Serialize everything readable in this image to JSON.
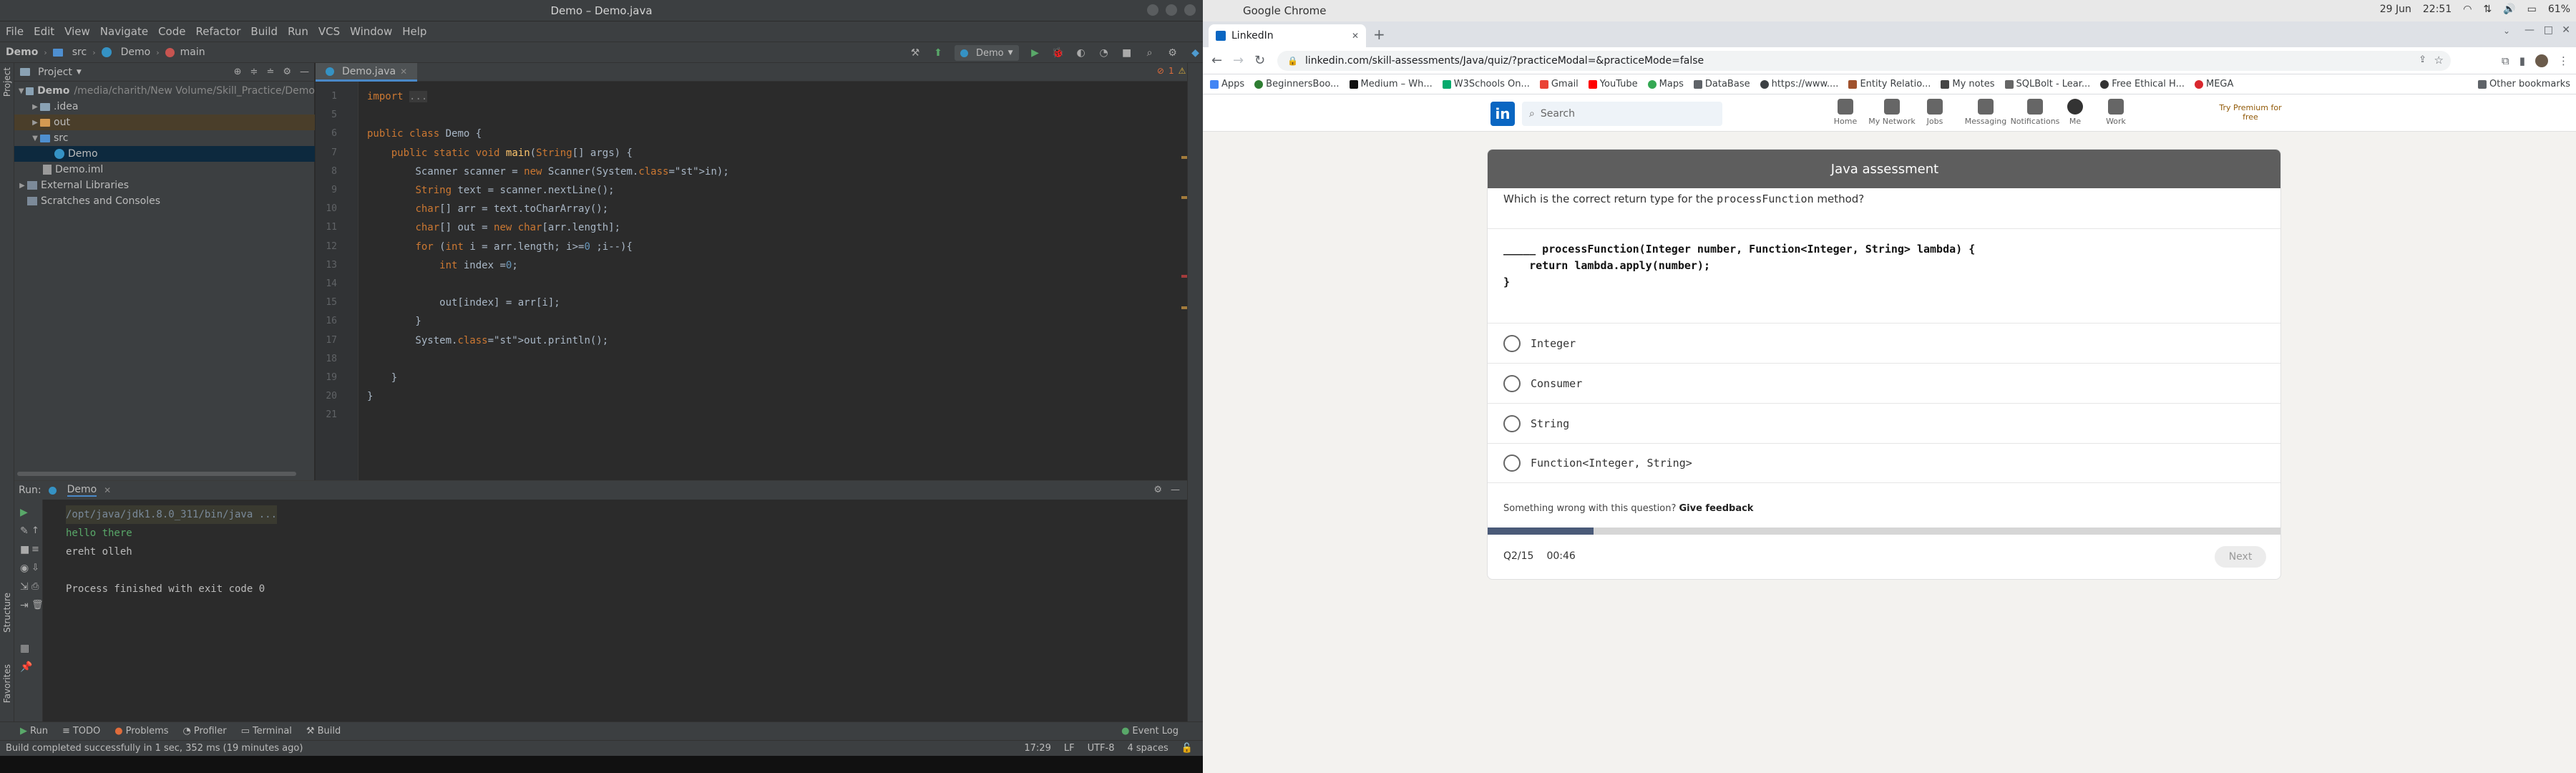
{
  "ide": {
    "window_title": "Demo – Demo.java",
    "menu": [
      "File",
      "Edit",
      "View",
      "Navigate",
      "Code",
      "Refactor",
      "Build",
      "Run",
      "VCS",
      "Window",
      "Help"
    ],
    "breadcrumbs": [
      "Demo",
      "src",
      "Demo",
      "main"
    ],
    "run_config": "Demo",
    "project_panel": {
      "title": "Project",
      "tree": [
        {
          "label": "Demo",
          "suffix": "/media/charith/New Volume/Skill_Practice/Demo",
          "kind": "folder",
          "level": 0
        },
        {
          "label": ".idea",
          "kind": "folder",
          "level": 1
        },
        {
          "label": "out",
          "kind": "folder-orange",
          "level": 1
        },
        {
          "label": "src",
          "kind": "folder-blue",
          "level": 1
        },
        {
          "label": "Demo",
          "kind": "class",
          "level": 2,
          "selected": true
        },
        {
          "label": "Demo.iml",
          "kind": "file",
          "level": 1
        },
        {
          "label": "External Libraries",
          "kind": "lib",
          "level": 0
        },
        {
          "label": "Scratches and Consoles",
          "kind": "scratch",
          "level": 0
        }
      ]
    },
    "editor_tab": "Demo.java",
    "warnings": {
      "errors": "1",
      "warnings": "5"
    },
    "code_lines": [
      {
        "n": "1",
        "text": "import ..."
      },
      {
        "n": "5",
        "text": ""
      },
      {
        "n": "6",
        "text": "public class Demo {"
      },
      {
        "n": "7",
        "text": "    public static void main(String[] args) {"
      },
      {
        "n": "8",
        "text": "        Scanner scanner = new Scanner(System.in);"
      },
      {
        "n": "9",
        "text": "        String text = scanner.nextLine();"
      },
      {
        "n": "10",
        "text": "        char[] arr = text.toCharArray();"
      },
      {
        "n": "11",
        "text": "        char[] out = new char[arr.length];"
      },
      {
        "n": "12",
        "text": "        for (int i = arr.length; i>=0 ;i--){"
      },
      {
        "n": "13",
        "text": "            int index =0;"
      },
      {
        "n": "14",
        "text": ""
      },
      {
        "n": "15",
        "text": "            out[index] = arr[i];"
      },
      {
        "n": "16",
        "text": "        }"
      },
      {
        "n": "17",
        "text": "        System.out.println();"
      },
      {
        "n": "18",
        "text": ""
      },
      {
        "n": "19",
        "text": "    }"
      },
      {
        "n": "20",
        "text": "}"
      },
      {
        "n": "21",
        "text": ""
      }
    ],
    "run": {
      "label": "Run:",
      "tab": "Demo",
      "output": [
        "/opt/java/jdk1.8.0_311/bin/java ...",
        "hello there",
        "ereht olleh",
        "",
        "Process finished with exit code 0"
      ]
    },
    "left_tabs": [
      "Project",
      "Structure",
      "Favorites"
    ],
    "bottom_tabs": [
      "Run",
      "TODO",
      "Problems",
      "Profiler",
      "Terminal",
      "Build"
    ],
    "event_log": "Event Log",
    "status_message": "Build completed successfully in 1 sec, 352 ms (19 minutes ago)",
    "status_right": [
      "17:29",
      "LF",
      "UTF-8",
      "4 spaces"
    ]
  },
  "system": {
    "app": "Google Chrome",
    "date": "29 Jun",
    "time": "22:51",
    "battery": "61%"
  },
  "chrome": {
    "tab_title": "LinkedIn",
    "url": "linkedin.com/skill-assessments/Java/quiz/?practiceModal=&practiceMode=false",
    "bookmarks": [
      "Apps",
      "BeginnersBoo...",
      "Medium – Wh...",
      "W3Schools On...",
      "Gmail",
      "YouTube",
      "Maps",
      "DataBase",
      "https://www....",
      "Entity Relatio...",
      "My notes",
      "SQLBolt - Lear...",
      "Free Ethical H...",
      "MEGA"
    ],
    "other_bookmarks": "Other bookmarks"
  },
  "linkedin": {
    "search_placeholder": "Search",
    "nav": [
      "Home",
      "My Network",
      "Jobs",
      "Messaging",
      "Notifications",
      "Me",
      "Work"
    ],
    "premium": "Try Premium for free",
    "quiz": {
      "title": "Java assessment",
      "question_pre": "Which is the correct return type for the ",
      "question_code": "processFunction",
      "question_post": " method?",
      "code": [
        "_____ processFunction(Integer number, Function<Integer, String> lambda) {",
        "    return lambda.apply(number);",
        "}"
      ],
      "options": [
        "Integer",
        "Consumer",
        "String",
        "Function<Integer, String>"
      ],
      "feedback_pre": "Something wrong with this question? ",
      "feedback_link": "Give feedback",
      "progress": 0.133,
      "counter": "Q2/15",
      "timer": "00:46",
      "next": "Next"
    }
  }
}
